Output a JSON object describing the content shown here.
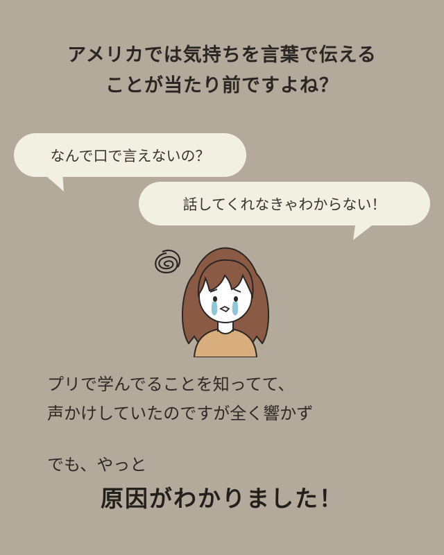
{
  "headline": {
    "line1": "アメリカでは気持ちを言葉で伝える",
    "line2": "ことが当たり前ですよね？"
  },
  "bubbles": [
    {
      "text": "なんで口で言えないの？"
    },
    {
      "text": "話してくれなきゃわからない！"
    }
  ],
  "illustration": {
    "icon": "crying-woman-icon",
    "scribble": "confusion-scribble-icon"
  },
  "body": {
    "line1": "プリで学んでることを知ってて、",
    "line2": "声かけしていたのですが全く響かず"
  },
  "sub": "でも、やっと",
  "conclusion": "原因がわかりました！",
  "colors": {
    "background": "#b4aa9b",
    "bubble": "#f2efe3",
    "hair": "#8a5a45",
    "sweater": "#d9ae7e",
    "tears": "#8fc6d8"
  }
}
